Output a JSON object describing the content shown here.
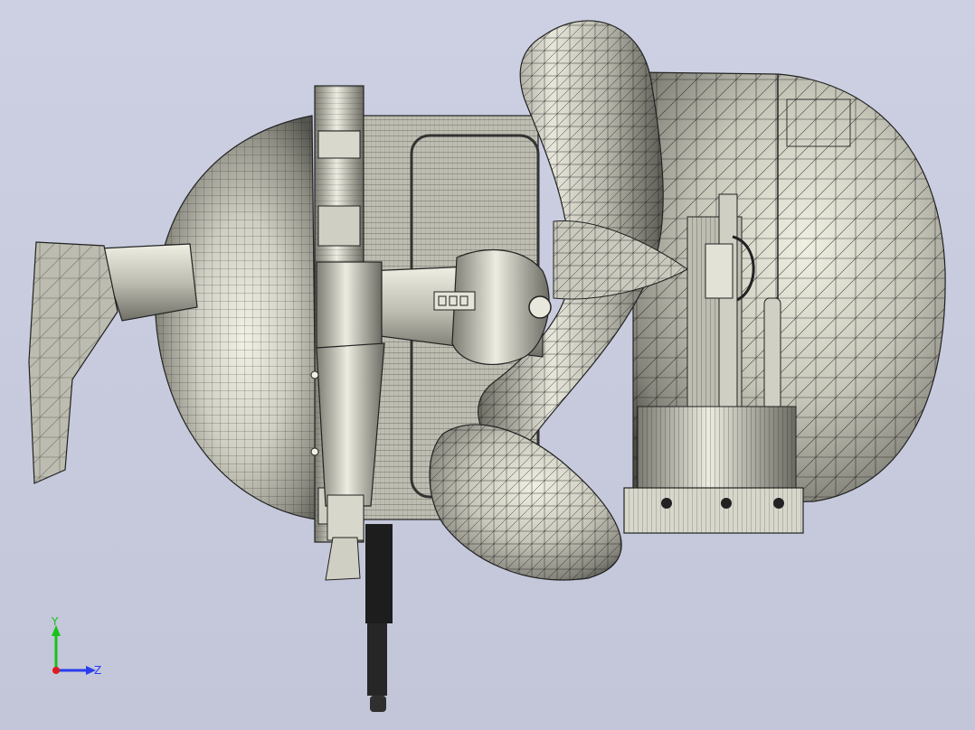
{
  "viewport": {
    "background_top": "#ccd0e2",
    "background_bottom": "#c2c6d8",
    "mesh_fill": "#b9b8ad",
    "mesh_light": "#e8e8dc",
    "mesh_dark": "#5f5f58",
    "edge_color": "#1b1b1b"
  },
  "triad": {
    "y_label": "Y",
    "z_label": "Z",
    "y_color": "#19c219",
    "z_color": "#2a3cf0",
    "x_color": "#e01a1a"
  }
}
